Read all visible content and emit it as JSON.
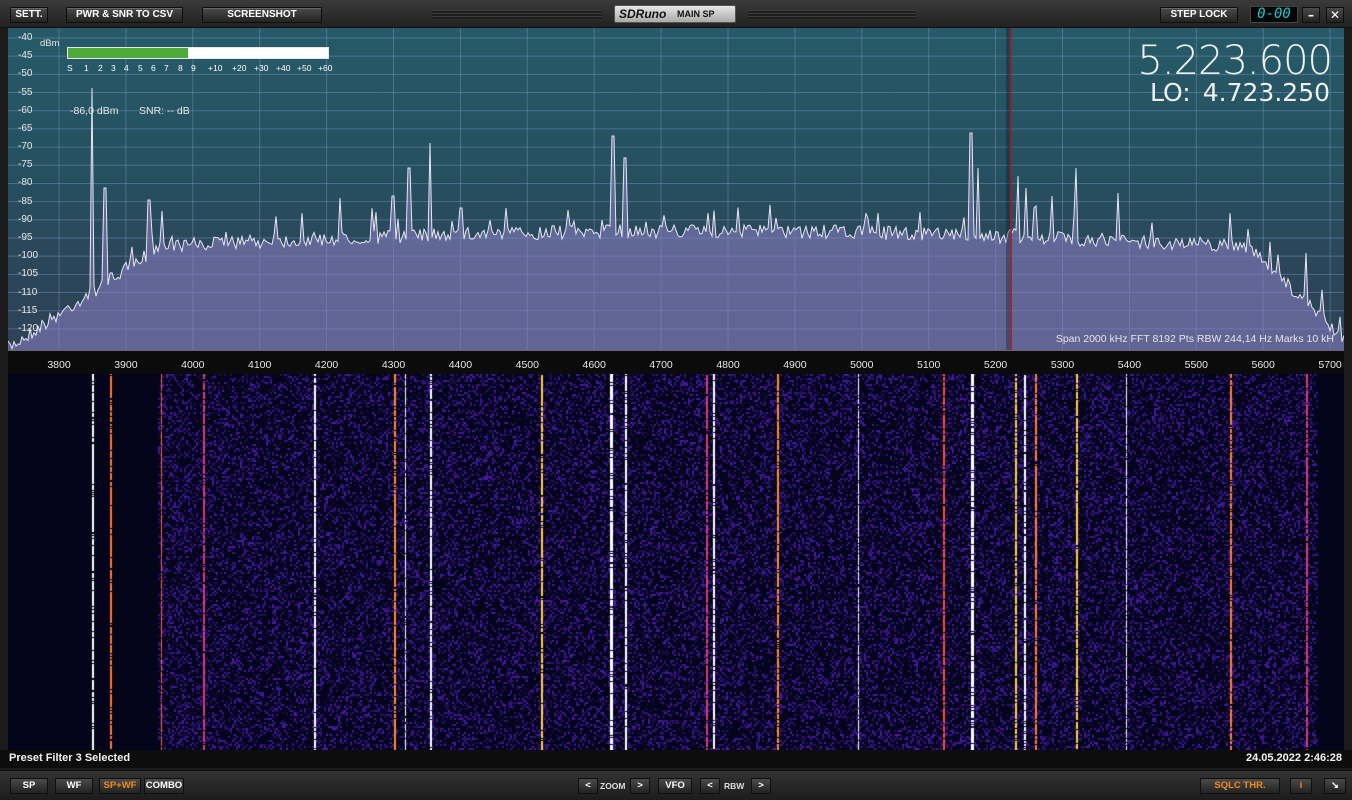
{
  "toolbar": {
    "settings_label": "SETT.",
    "pwr_snr_label": "PWR & SNR TO CSV",
    "screenshot_label": "SCREENSHOT",
    "brand_logo": "SDRuno",
    "brand_sub": "MAIN SP",
    "step_lock_label": "STEP LOCK",
    "segment_display": "0-00",
    "minimize_glyph": "–",
    "close_glyph": "✕"
  },
  "spectrum": {
    "unit_label": "dBm",
    "y_ticks": [
      "-40",
      "-45",
      "-50",
      "-55",
      "-60",
      "-65",
      "-70",
      "-75",
      "-80",
      "-85",
      "-90",
      "-95",
      "-100",
      "-105",
      "-110",
      "-115",
      "-120"
    ],
    "x_ticks": [
      "3800",
      "3900",
      "4000",
      "4100",
      "4200",
      "4300",
      "4400",
      "4500",
      "4600",
      "4700",
      "4800",
      "4900",
      "5000",
      "5100",
      "5200",
      "5300",
      "5400",
      "5500",
      "5600",
      "5700"
    ],
    "smeter_ticks": [
      "S",
      "1",
      "2",
      "3",
      "4",
      "5",
      "6",
      "7",
      "8",
      "9",
      "+10",
      "+20",
      "+30",
      "+40",
      "+50",
      "+60"
    ],
    "smeter_level_fraction": 0.46,
    "level_readout": "-86,0 dBm",
    "snr_readout": "SNR:  -- dB",
    "vfo_frequency": "5.223.600",
    "lo_label": "LO:",
    "lo_frequency": "4.723.250",
    "span_info": "Span 2000 kHz   FFT 8192 Pts   RBW 244,14 Hz   Marks 10 kH",
    "colors": {
      "trace": "#e6e6f0",
      "fill": "#8c82c8",
      "vfo_marker": "#b02020",
      "smeter_fill": "#4eaa3a",
      "active_button": "#f08b1a"
    }
  },
  "status": {
    "left": "Preset Filter 3 Selected",
    "right": "24.05.2022 2:46:28"
  },
  "bottom": {
    "sp_label": "SP",
    "wf_label": "WF",
    "spwf_label": "SP+WF",
    "combo_label": "COMBO",
    "zoom_left": "<",
    "zoom_label": "ZOOM",
    "zoom_right": ">",
    "vfo_label": "VFO",
    "rbw_left": "<",
    "rbw_label": "RBW",
    "rbw_right": ">",
    "sqlc_label": "SQLC THR.",
    "info_label": "i",
    "resize_glyph": "↘"
  }
}
